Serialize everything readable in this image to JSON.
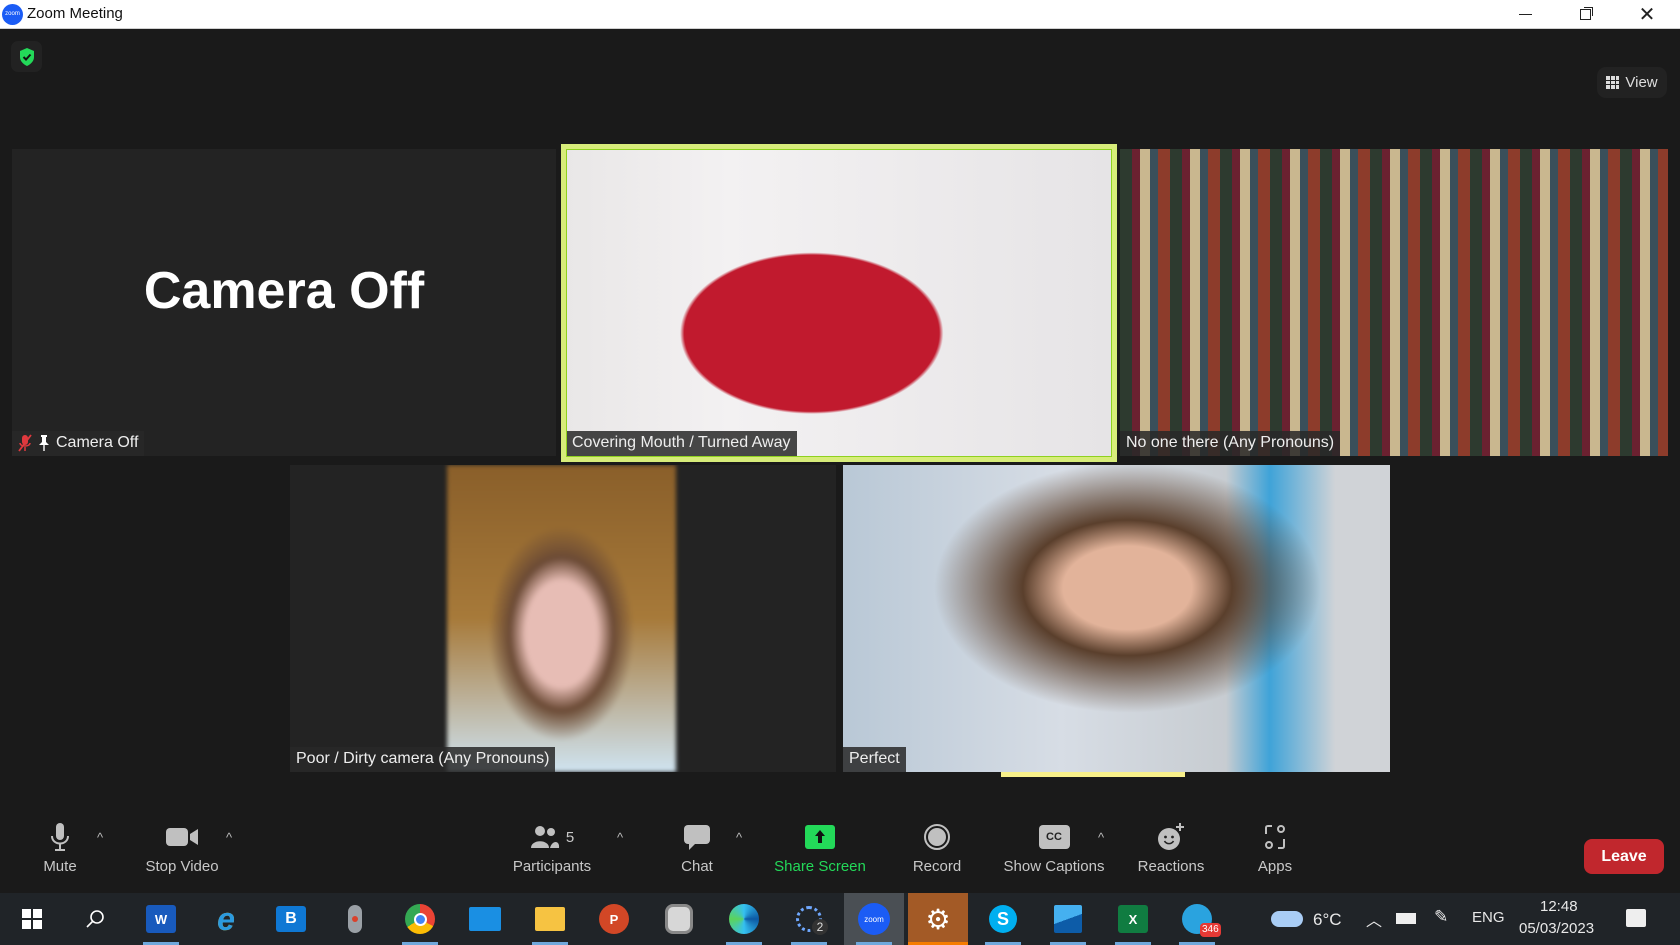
{
  "window": {
    "title": "Zoom Meeting",
    "app_logo_text": "zoom",
    "controls": [
      "minimize",
      "restore",
      "close"
    ]
  },
  "header": {
    "security_icon": "shield-check-icon",
    "view_label": "View"
  },
  "tiles": [
    {
      "name": "Camera Off",
      "camera_off_text": "Camera Off",
      "muted": true,
      "pinned": true,
      "video": false
    },
    {
      "name": "Covering Mouth / Turned Away",
      "active_speaker": true,
      "video": true
    },
    {
      "name": "No one there (Any Pronouns)",
      "video": true
    },
    {
      "name": "Poor / Dirty camera (Any Pronouns)",
      "video": true
    },
    {
      "name": "Perfect",
      "video": true,
      "speaking_indicator": true
    }
  ],
  "toolbar": {
    "mute": "Mute",
    "stop_video": "Stop Video",
    "participants": "Participants",
    "participants_count": "5",
    "chat": "Chat",
    "share_screen": "Share Screen",
    "record": "Record",
    "show_captions": "Show Captions",
    "captions_badge": "CC",
    "reactions": "Reactions",
    "apps": "Apps",
    "leave": "Leave"
  },
  "colors": {
    "share_green": "#23d959",
    "leave_red": "#c1272d",
    "active_border": "#d7ec7a",
    "muted_red": "#e0393e"
  },
  "taskbar": {
    "apps": [
      "windows-start",
      "search",
      "word",
      "internet-explorer",
      "bookings",
      "microphone-app",
      "chrome",
      "mail",
      "file-explorer",
      "powerpoint",
      "clock",
      "edge",
      "signal",
      "zoom",
      "settings",
      "skype",
      "photos",
      "excel",
      "telegram"
    ],
    "signal_badge": "2",
    "telegram_badge": "346",
    "weather": "6°C",
    "language": "ENG",
    "time": "12:48",
    "date": "05/03/2023"
  }
}
